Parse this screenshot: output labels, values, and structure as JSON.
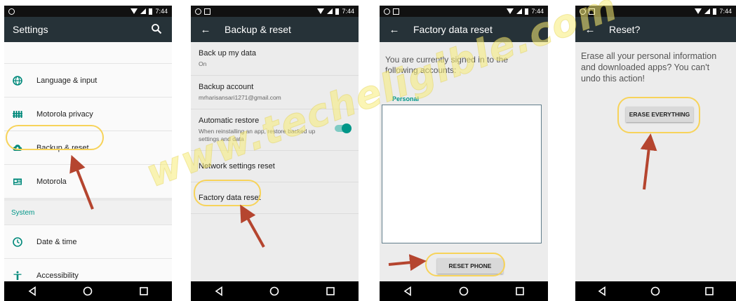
{
  "statusbar": {
    "time": "7:44"
  },
  "panel1": {
    "title": "Settings",
    "items": [
      {
        "label": "Language & input",
        "icon": "globe-icon"
      },
      {
        "label": "Motorola privacy",
        "icon": "motorola-privacy-icon"
      },
      {
        "label": "Backup & reset",
        "icon": "cloud-upload-icon"
      },
      {
        "label": "Motorola",
        "icon": "motorola-id-icon"
      }
    ],
    "section_header": "System",
    "system_items": [
      {
        "label": "Date & time",
        "icon": "clock-icon"
      },
      {
        "label": "Accessibility",
        "icon": "accessibility-icon"
      }
    ]
  },
  "panel2": {
    "title": "Backup & reset",
    "items": [
      {
        "title": "Back up my data",
        "subtitle": "On"
      },
      {
        "title": "Backup account",
        "subtitle": "mrharisansari1271@gmail.com"
      },
      {
        "title": "Automatic restore",
        "subtitle": "When reinstalling an app, restore backed up settings and data"
      },
      {
        "title": "Network settings reset",
        "subtitle": ""
      },
      {
        "title": "Factory data reset",
        "subtitle": ""
      }
    ]
  },
  "panel3": {
    "title": "Factory data reset",
    "message": "You are currently signed in to the following accounts:",
    "personal_label": "Personal",
    "button": "RESET PHONE"
  },
  "panel4": {
    "title": "Reset?",
    "message": "Erase all your personal information and downloaded apps? You can't undo this action!",
    "button": "ERASE EVERYTHING"
  },
  "watermark": "www.techeligible.com",
  "colors": {
    "toolbar": "#263238",
    "accent": "#009688",
    "highlight": "#f7d35a",
    "arrow": "#b5452f"
  }
}
